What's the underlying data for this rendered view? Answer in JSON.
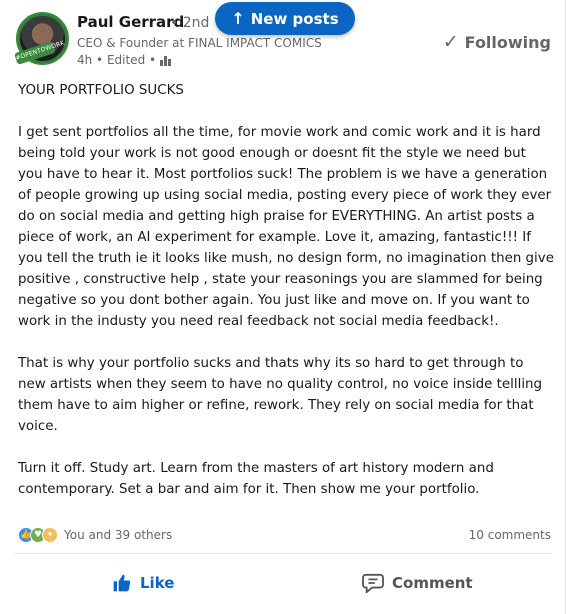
{
  "banner": {
    "new_posts_label": "New posts",
    "icon": "arrow-up-icon"
  },
  "author": {
    "name": "Paul Gerrard",
    "degree": "• 2nd",
    "headline": "CEO & Founder at FINAL IMPACT COMICS",
    "meta": "4h • Edited •",
    "avatar_banner": "#OPENTOWORK",
    "follow_state": "Following"
  },
  "post": {
    "paragraphs": [
      "YOUR PORTFOLIO SUCKS",
      "I get sent portfolios all the time, for movie work and comic work and it is hard being told your work is not good enough or doesnt fit the style we need but you have to hear it. Most portfolios suck! The problem is we have a generation of people growing up using social media, posting every piece of work they ever do on social media and getting high praise for EVERYTHING. An artist posts a piece of work, an AI experiment for example. Love it, amazing, fantastic!!! If you tell the truth ie it looks like mush, no design form, no imagination then give positive , constructive help , state your reasonings you are slammed for being negative so you dont bother again. You just like and move on. If you want to work in the industy you need real feedback not social media feedback!.",
      "That is why your portfolio sucks and thats why its so hard to get through to new artists when they seem to have no quality control, no voice inside tellling them have to aim higher or refine, rework. They rely on social media for that voice.",
      "Turn it off. Study art. Learn from the masters of art history modern and contemporary. Set a bar and aim for it. Then show me your portfolio."
    ]
  },
  "social": {
    "reactions_text": "You and 39 others",
    "comments_text": "10 comments"
  },
  "actions": {
    "like_label": "Like",
    "comment_label": "Comment"
  },
  "colors": {
    "accent": "#0a66c2",
    "muted": "#666666",
    "open_to_work": "#3b8a3e"
  }
}
